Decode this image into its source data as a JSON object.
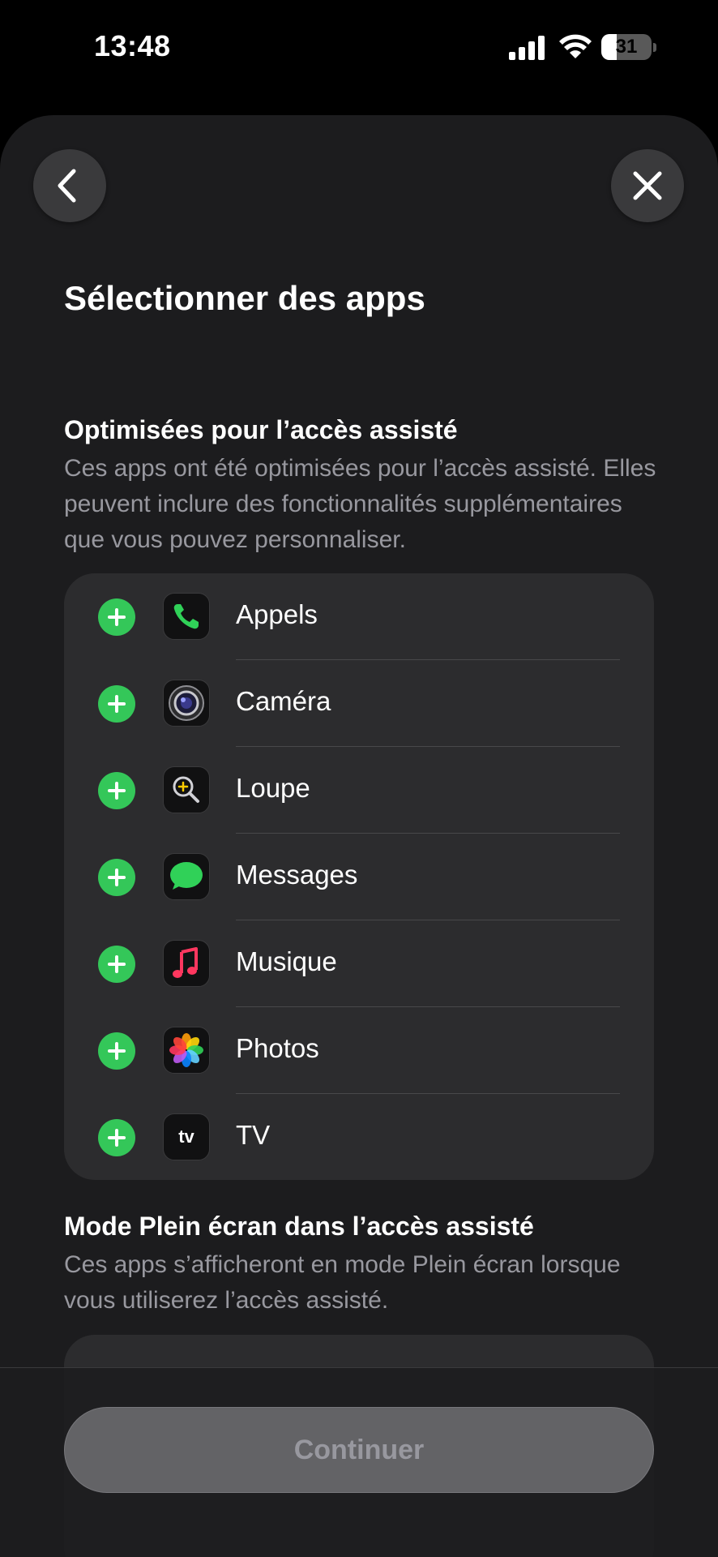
{
  "status_bar": {
    "time": "13:48",
    "battery_level": "31",
    "battery_fraction": 0.31
  },
  "nav": {
    "back_icon": "chevron-left-icon",
    "close_icon": "close-icon"
  },
  "page_title": "Sélectionner des apps",
  "sections": [
    {
      "title": "Optimisées pour l’accès assisté",
      "description": "Ces apps ont été optimisées pour l’accès assisté. Elles peuvent inclure des fonctionnalités supplémentaires que vous pouvez personnaliser.",
      "apps": [
        {
          "label": "Appels",
          "icon": "phone-icon"
        },
        {
          "label": "Caméra",
          "icon": "camera-icon"
        },
        {
          "label": "Loupe",
          "icon": "magnifier-icon"
        },
        {
          "label": "Messages",
          "icon": "messages-icon"
        },
        {
          "label": "Musique",
          "icon": "music-icon"
        },
        {
          "label": "Photos",
          "icon": "photos-icon"
        },
        {
          "label": "TV",
          "icon": "tv-icon",
          "icon_text": "tv"
        }
      ]
    },
    {
      "title": "Mode Plein écran dans l’accès assisté",
      "description": "Ces apps s’afficheront en mode Plein écran lorsque vous utiliserez l’accès assisté."
    }
  ],
  "footer": {
    "continue_label": "Continuer"
  },
  "colors": {
    "add_button": "#34c759",
    "sheet_background": "#1c1c1e",
    "card_background": "#2c2c2e",
    "secondary_text": "#98989f"
  }
}
